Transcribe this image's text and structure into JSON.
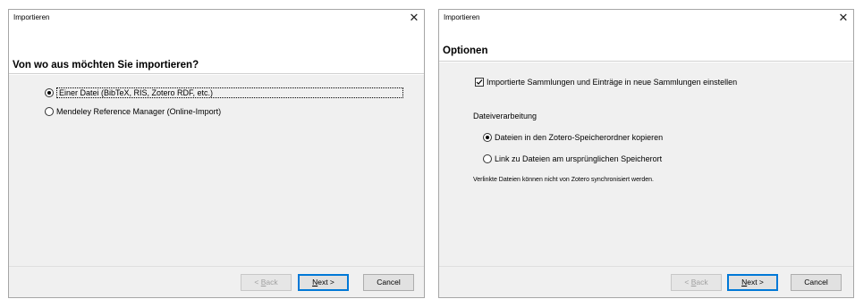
{
  "left_dialog": {
    "title": "Importieren",
    "close_glyph": "✕",
    "heading": "Von wo aus möchten Sie importieren?",
    "options": [
      {
        "label": "Einer Datei (BibTeX, RIS, Zotero RDF, etc.)",
        "selected": true
      },
      {
        "label": "Mendeley Reference Manager (Online-Import)",
        "selected": false
      }
    ],
    "buttons": {
      "back_prefix": "< ",
      "back_key": "B",
      "back_rest": "ack",
      "next_key": "N",
      "next_rest": "ext >",
      "cancel": "Cancel"
    }
  },
  "right_dialog": {
    "title": "Importieren",
    "close_glyph": "✕",
    "heading": "Optionen",
    "checkbox": {
      "label": "Importierte Sammlungen und Einträge in neue Sammlungen einstellen",
      "checked": true
    },
    "file_section_label": "Dateiverarbeitung",
    "options": [
      {
        "label": "Dateien in den Zotero-Speicherordner kopieren",
        "selected": true
      },
      {
        "label": "Link zu Dateien am ursprünglichen Speicherort",
        "selected": false
      }
    ],
    "note": "Verlinkte Dateien können nicht von Zotero synchronisiert werden.",
    "buttons": {
      "back_prefix": "< ",
      "back_key": "B",
      "back_rest": "ack",
      "next_key": "N",
      "next_rest": "ext >",
      "cancel": "Cancel"
    }
  },
  "icons": {
    "radio": "radio-button-icon",
    "checkbox": "checkbox-icon",
    "close": "close-icon"
  },
  "colors": {
    "default_button_border": "#0078d7",
    "panel_bg": "#f0f0f0"
  }
}
